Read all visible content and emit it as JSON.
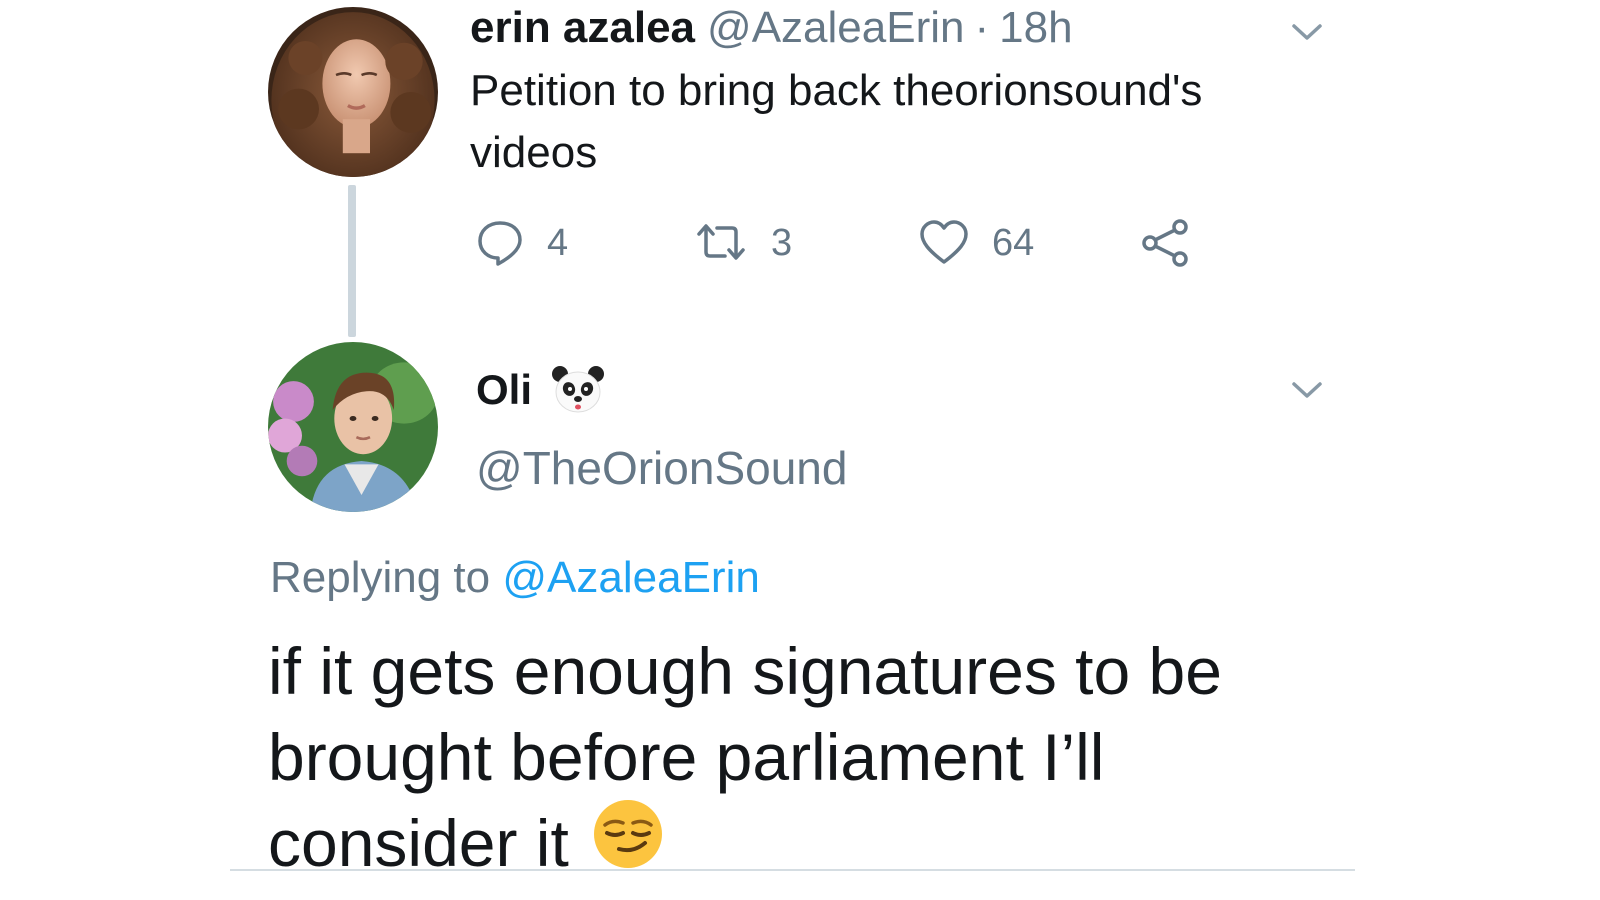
{
  "tweet": {
    "author_name": "erin azalea",
    "author_handle": "@AzaleaErin",
    "separator": "·",
    "timestamp": "18h",
    "text": "Petition to bring back theorionsound's videos",
    "avatar_icon": "avatar-woman-curly-hair",
    "menu_icon": "chevron-down-icon",
    "actions": {
      "reply": {
        "icon": "reply-icon",
        "count": "4"
      },
      "retweet": {
        "icon": "retweet-icon",
        "count": "3"
      },
      "like": {
        "icon": "heart-icon",
        "count": "64"
      },
      "share": {
        "icon": "share-icon"
      }
    }
  },
  "reply": {
    "author_name": "Oli",
    "name_emoji": "panda-emoji",
    "author_handle": "@TheOrionSound",
    "avatar_icon": "avatar-young-man",
    "menu_icon": "chevron-down-icon",
    "replying_prefix": "Replying to",
    "replying_mention": "@AzaleaErin",
    "text": "if it gets enough signatures to be brought before parliament I’ll consider it",
    "trailing_emoji": "smirk-emoji"
  },
  "colors": {
    "text_primary": "#14171a",
    "text_secondary": "#657786",
    "link": "#1da1f2",
    "thread_line": "#ccd6dd"
  }
}
